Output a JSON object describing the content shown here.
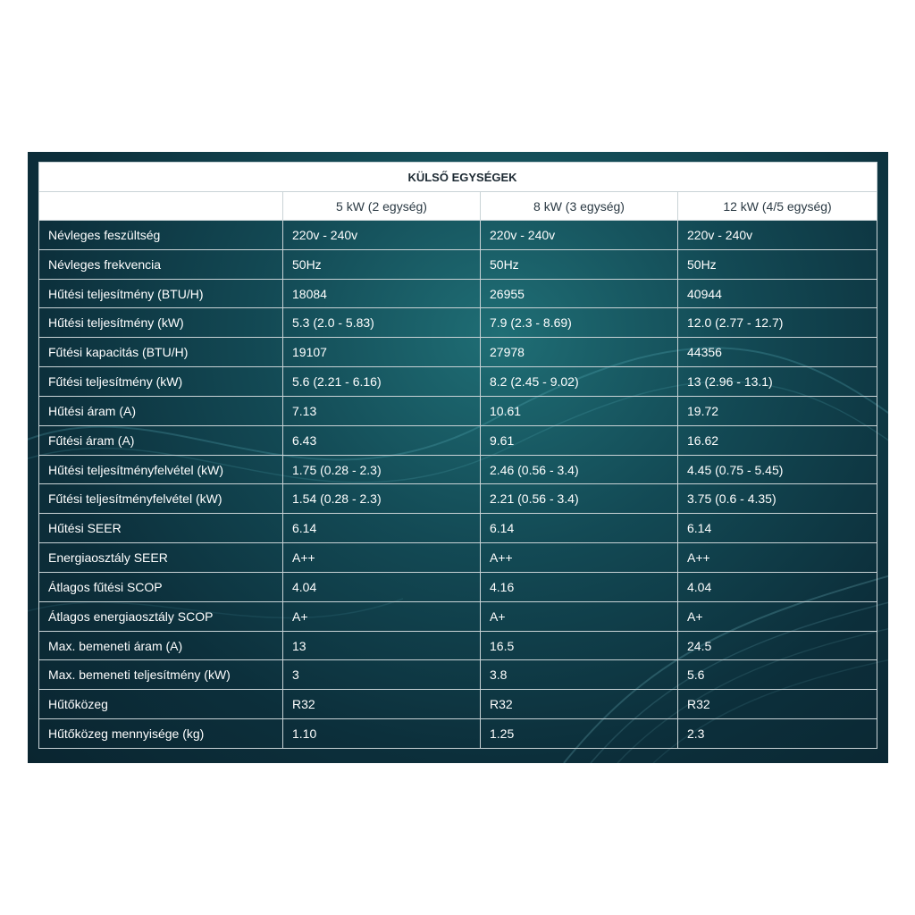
{
  "table": {
    "title": "KÜLSŐ EGYSÉGEK",
    "columns": [
      "",
      "5 kW (2 egység)",
      "8 kW (3 egység)",
      "12 kW (4/5 egység)"
    ],
    "rows": [
      [
        "Névleges feszültség",
        "220v - 240v",
        "220v - 240v",
        "220v - 240v"
      ],
      [
        "Névleges frekvencia",
        "50Hz",
        "50Hz",
        "50Hz"
      ],
      [
        "Hűtési teljesítmény (BTU/H)",
        "18084",
        "26955",
        "40944"
      ],
      [
        "Hűtési teljesítmény (kW)",
        "5.3 (2.0 - 5.83)",
        "7.9 (2.3 - 8.69)",
        "12.0 (2.77 - 12.7)"
      ],
      [
        "Fűtési kapacitás (BTU/H)",
        "19107",
        "27978",
        "44356"
      ],
      [
        "Fűtési teljesítmény (kW)",
        "5.6 (2.21 - 6.16)",
        "8.2 (2.45 - 9.02)",
        "13 (2.96 - 13.1)"
      ],
      [
        "Hűtési áram (A)",
        "7.13",
        "10.61",
        "19.72"
      ],
      [
        "Fűtési áram (A)",
        "6.43",
        "9.61",
        "16.62"
      ],
      [
        "Hűtési teljesítményfelvétel (kW)",
        "1.75 (0.28 - 2.3)",
        "2.46 (0.56 - 3.4)",
        "4.45 (0.75 - 5.45)"
      ],
      [
        "Fűtési teljesítményfelvétel (kW)",
        "1.54 (0.28 - 2.3)",
        "2.21 (0.56 - 3.4)",
        "3.75 (0.6 - 4.35)"
      ],
      [
        "Hűtési SEER",
        "6.14",
        "6.14",
        "6.14"
      ],
      [
        "Energiaosztály SEER",
        "A++",
        "A++",
        "A++"
      ],
      [
        "Átlagos fűtési SCOP",
        "4.04",
        "4.16",
        "4.04"
      ],
      [
        "Átlagos energiaosztály SCOP",
        "A+",
        "A+",
        "A+"
      ],
      [
        "Max. bemeneti áram (A)",
        "13",
        "16.5",
        "24.5"
      ],
      [
        "Max. bemeneti teljesítmény (kW)",
        "3",
        "3.8",
        "5.6"
      ],
      [
        "Hűtőközeg",
        "R32",
        "R32",
        "R32"
      ],
      [
        "Hűtőközeg mennyisége (kg)",
        "1.10",
        "1.25",
        "2.3"
      ]
    ]
  },
  "colors": {
    "panel_dark": "#0c2f3b",
    "panel_teal": "#1f6e75",
    "grid_line": "#c9d3d6",
    "header_bg": "#ffffff"
  }
}
